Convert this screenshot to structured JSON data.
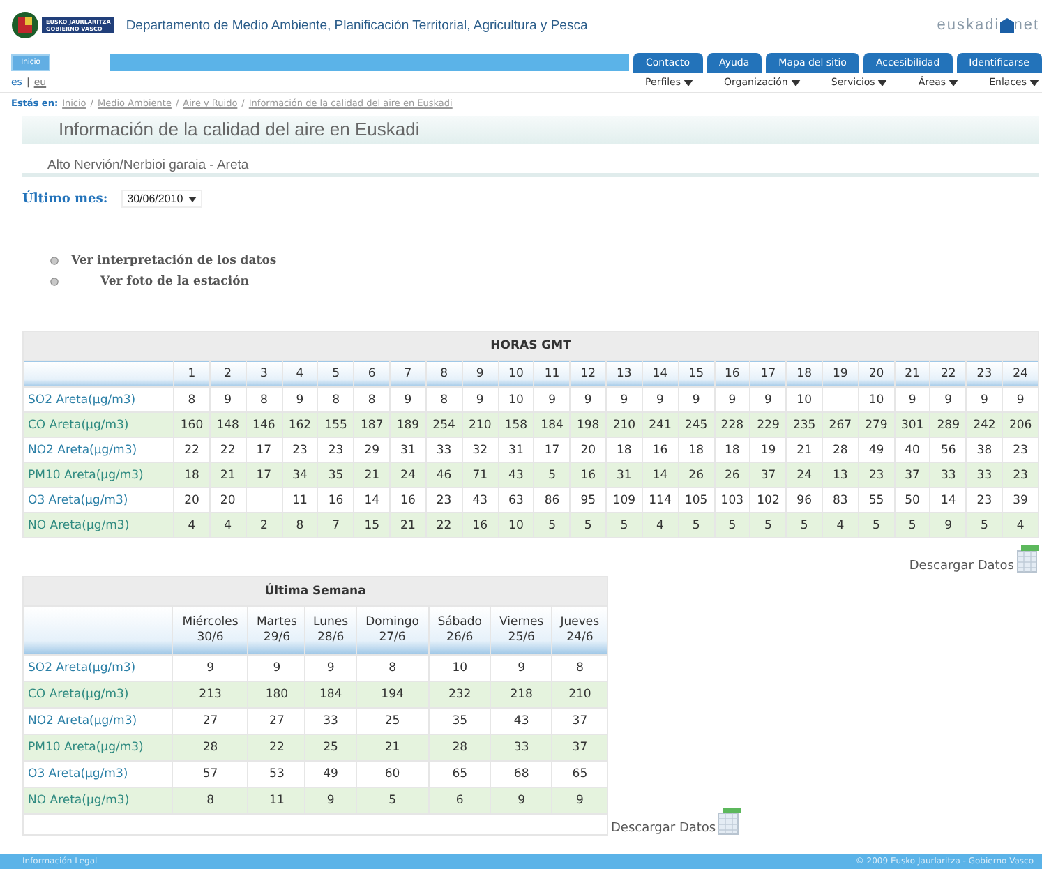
{
  "header": {
    "logo_lines": [
      "EUSKO JAURLARITZA",
      "GOBIERNO VASCO"
    ],
    "department": "Departamento de Medio Ambiente, Planificación Territorial, Agricultura y Pesca",
    "brand": [
      "euskadi",
      "net"
    ]
  },
  "nav": {
    "home": "Inicio",
    "tabs": [
      "Contacto",
      "Ayuda",
      "Mapa del sitio",
      "Accesibilidad",
      "Identificarse"
    ],
    "languages": [
      {
        "label": "es",
        "selected": true
      },
      {
        "label": "eu",
        "selected": false
      }
    ],
    "language_separator": "|",
    "menus": [
      "Perfiles",
      "Organización",
      "Servicios",
      "Áreas",
      "Enlaces"
    ]
  },
  "breadcrumb": {
    "label": "Estás en:",
    "separator": "/",
    "items": [
      "Inicio",
      "Medio Ambiente",
      "Aire y Ruido",
      "Información de la calidad del aire en Euskadi"
    ]
  },
  "title": "Información de la calidad del aire en Euskadi",
  "subtitle": "Alto Nervión/Nerbioi garaia - Areta",
  "month": {
    "label": "Último mes:",
    "value": "30/06/2010"
  },
  "links": [
    "Ver interpretación de los datos",
    "Ver foto de la estación"
  ],
  "hourly": {
    "title": "HORAS GMT",
    "columns": [
      "1",
      "2",
      "3",
      "4",
      "5",
      "6",
      "7",
      "8",
      "9",
      "10",
      "11",
      "12",
      "13",
      "14",
      "15",
      "16",
      "17",
      "18",
      "19",
      "20",
      "21",
      "22",
      "23",
      "24"
    ],
    "rows": [
      {
        "label": "SO2 Areta(µg/m3)",
        "cells": [
          {
            "text": "8"
          },
          {
            "text": "9"
          },
          {
            "text": "8"
          },
          {
            "text": "9"
          },
          {
            "text": "8"
          },
          {
            "text": "8"
          },
          {
            "text": "9"
          },
          {
            "text": "8"
          },
          {
            "text": "9"
          },
          {
            "text": "10"
          },
          {
            "text": "9"
          },
          {
            "text": "9"
          },
          {
            "text": "9"
          },
          {
            "text": "9"
          },
          {
            "text": "9"
          },
          {
            "text": "9"
          },
          {
            "text": "9"
          },
          {
            "text": "10"
          },
          {},
          {
            "text": "10"
          },
          {
            "text": "9"
          },
          {
            "text": "9"
          },
          {
            "text": "9"
          },
          {
            "text": "9"
          }
        ]
      },
      {
        "label": "CO Areta(µg/m3)",
        "cells": [
          {
            "text": "160"
          },
          {
            "text": "148"
          },
          {
            "text": "146"
          },
          {
            "text": "162"
          },
          {
            "text": "155"
          },
          {
            "text": "187"
          },
          {
            "text": "189"
          },
          {
            "text": "254"
          },
          {
            "text": "210"
          },
          {
            "text": "158"
          },
          {
            "text": "184"
          },
          {
            "text": "198"
          },
          {
            "text": "210"
          },
          {
            "text": "241"
          },
          {
            "text": "245"
          },
          {
            "text": "228"
          },
          {
            "text": "229"
          },
          {
            "text": "235"
          },
          {
            "text": "267"
          },
          {
            "text": "279"
          },
          {
            "text": "301"
          },
          {
            "text": "289"
          },
          {
            "text": "242"
          },
          {
            "text": "206"
          }
        ]
      },
      {
        "label": "NO2 Areta(µg/m3)",
        "cells": [
          {
            "text": "22"
          },
          {
            "text": "22"
          },
          {
            "text": "17"
          },
          {
            "text": "23"
          },
          {
            "text": "23"
          },
          {
            "text": "29"
          },
          {
            "text": "31"
          },
          {
            "text": "33"
          },
          {
            "text": "32"
          },
          {
            "text": "31"
          },
          {
            "text": "17"
          },
          {
            "text": "20"
          },
          {
            "text": "18"
          },
          {
            "text": "16"
          },
          {
            "text": "18"
          },
          {
            "text": "18"
          },
          {
            "text": "19"
          },
          {
            "text": "21"
          },
          {
            "text": "28"
          },
          {
            "text": "49"
          },
          {
            "text": "40"
          },
          {
            "text": "56"
          },
          {
            "text": "38"
          },
          {
            "text": "23"
          }
        ]
      },
      {
        "label": "PM10 Areta(µg/m3)",
        "cells": [
          {
            "text": "18"
          },
          {
            "text": "21"
          },
          {
            "text": "17"
          },
          {
            "text": "34"
          },
          {
            "text": "35"
          },
          {
            "text": "21"
          },
          {
            "text": "24"
          },
          {
            "text": "46"
          },
          {
            "text": "71"
          },
          {
            "text": "43"
          },
          {
            "text": "5"
          },
          {
            "text": "16"
          },
          {
            "text": "31"
          },
          {
            "text": "14"
          },
          {
            "text": "26"
          },
          {
            "text": "26"
          },
          {
            "text": "37"
          },
          {
            "text": "24"
          },
          {
            "text": "13"
          },
          {
            "text": "23"
          },
          {
            "text": "37"
          },
          {
            "text": "33"
          },
          {
            "text": "33"
          },
          {
            "text": "23"
          }
        ]
      },
      {
        "label": "O3 Areta(µg/m3)",
        "cells": [
          {
            "text": "20"
          },
          {
            "text": "20"
          },
          {},
          {
            "text": "11"
          },
          {
            "text": "16"
          },
          {
            "text": "14"
          },
          {
            "text": "16"
          },
          {
            "text": "23"
          },
          {
            "text": "43"
          },
          {
            "text": "63"
          },
          {
            "text": "86"
          },
          {
            "text": "95"
          },
          {
            "text": "109"
          },
          {
            "text": "114"
          },
          {
            "text": "105"
          },
          {
            "text": "103"
          },
          {
            "text": "102"
          },
          {
            "text": "96"
          },
          {
            "text": "83"
          },
          {
            "text": "55"
          },
          {
            "text": "50"
          },
          {
            "text": "14"
          },
          {
            "text": "23"
          },
          {
            "text": "39"
          }
        ]
      },
      {
        "label": "NO Areta(µg/m3)",
        "cells": [
          {
            "text": "4"
          },
          {
            "text": "4"
          },
          {
            "text": "2"
          },
          {
            "text": "8"
          },
          {
            "text": "7"
          },
          {
            "text": "15"
          },
          {
            "text": "21"
          },
          {
            "text": "22"
          },
          {
            "text": "16"
          },
          {
            "text": "10"
          },
          {
            "text": "5"
          },
          {
            "text": "5"
          },
          {
            "text": "5"
          },
          {
            "text": "4"
          },
          {
            "text": "5"
          },
          {
            "text": "5"
          },
          {
            "text": "5"
          },
          {
            "text": "5"
          },
          {
            "text": "4"
          },
          {
            "text": "5"
          },
          {
            "text": "5"
          },
          {
            "text": "9"
          },
          {
            "text": "5"
          },
          {
            "text": "4"
          }
        ]
      }
    ],
    "download": "Descargar Datos"
  },
  "weekly": {
    "title": "Última Semana",
    "columns": [
      [
        "Miércoles",
        "30/6"
      ],
      [
        "Martes",
        "29/6"
      ],
      [
        "Lunes",
        "28/6"
      ],
      [
        "Domingo",
        "27/6"
      ],
      [
        "Sábado",
        "26/6"
      ],
      [
        "Viernes",
        "25/6"
      ],
      [
        "Jueves",
        "24/6"
      ]
    ],
    "rows": [
      {
        "label": "SO2 Areta(µg/m3)",
        "values": [
          "9",
          "9",
          "9",
          "8",
          "10",
          "9",
          "8"
        ]
      },
      {
        "label": "CO Areta(µg/m3)",
        "values": [
          "213",
          "180",
          "184",
          "194",
          "232",
          "218",
          "210"
        ]
      },
      {
        "label": "NO2 Areta(µg/m3)",
        "values": [
          "27",
          "27",
          "33",
          "25",
          "35",
          "43",
          "37"
        ]
      },
      {
        "label": "PM10 Areta(µg/m3)",
        "values": [
          "28",
          "22",
          "25",
          "21",
          "28",
          "33",
          "37"
        ]
      },
      {
        "label": "O3 Areta(µg/m3)",
        "values": [
          "57",
          "53",
          "49",
          "60",
          "65",
          "68",
          "65"
        ]
      },
      {
        "label": "NO Areta(µg/m3)",
        "values": [
          "8",
          "11",
          "9",
          "5",
          "6",
          "9",
          "9"
        ]
      }
    ],
    "download": "Descargar Datos"
  },
  "footer": {
    "left": "Información Legal",
    "right": "© 2009 Eusko Jaurlaritza - Gobierno Vasco"
  }
}
